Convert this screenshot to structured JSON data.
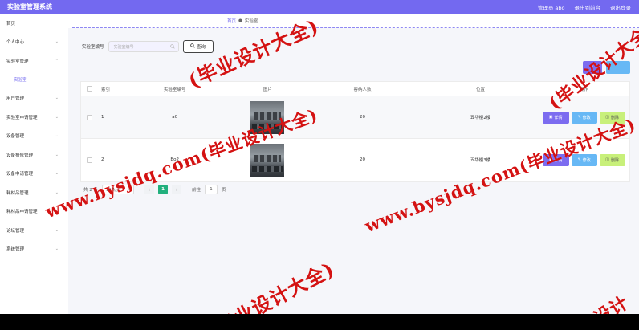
{
  "header": {
    "app_title": "实验室管理系统",
    "admin_label": "管理员 abo",
    "back_label": "退出到前台",
    "logout_label": "退出登录"
  },
  "sidebar": {
    "items": [
      {
        "label": "首页"
      },
      {
        "label": "个人中心"
      },
      {
        "label": "实验室管理"
      },
      {
        "label": "实验室"
      },
      {
        "label": "用户管理"
      },
      {
        "label": "实验室申请管理"
      },
      {
        "label": "设备管理"
      },
      {
        "label": "设备报修管理"
      },
      {
        "label": "设备申请管理"
      },
      {
        "label": "耗材品管理"
      },
      {
        "label": "耗材品申请管理"
      },
      {
        "label": "论坛管理"
      },
      {
        "label": "系统管理"
      }
    ]
  },
  "breadcrumb": {
    "home": "首页",
    "current": "实验室"
  },
  "search": {
    "label": "实验室编号",
    "placeholder": "实验室编号",
    "button_label": "查询"
  },
  "table": {
    "columns": [
      "索引",
      "实验室编号",
      "图片",
      "容纳人数",
      "位置",
      "操作"
    ],
    "rows": [
      {
        "index": "1",
        "number": "a0",
        "capacity": "20",
        "location": "五华楼2楼"
      },
      {
        "index": "2",
        "number": "Bo2",
        "capacity": "20",
        "location": "五华楼3楼"
      }
    ],
    "ops": {
      "detail": "详情",
      "edit": "修改",
      "delete": "删除"
    }
  },
  "pagination": {
    "total": "共 2 条",
    "page_size": "10条/页",
    "current_page": "1",
    "goto_label": "前往",
    "goto_value": "1",
    "page_unit": "页"
  },
  "watermark": {
    "text": "www.bysjdq.com(毕业设计大全)",
    "partial_1": "(毕业设计大全)",
    "partial_2": "毕业设计大全)",
    "partial_3": "业设计"
  },
  "colors": {
    "primary": "#7369f0",
    "edit": "#67b8f5",
    "delete": "#c8f07a",
    "page_active": "#22b07d",
    "watermark": "#d41212"
  }
}
